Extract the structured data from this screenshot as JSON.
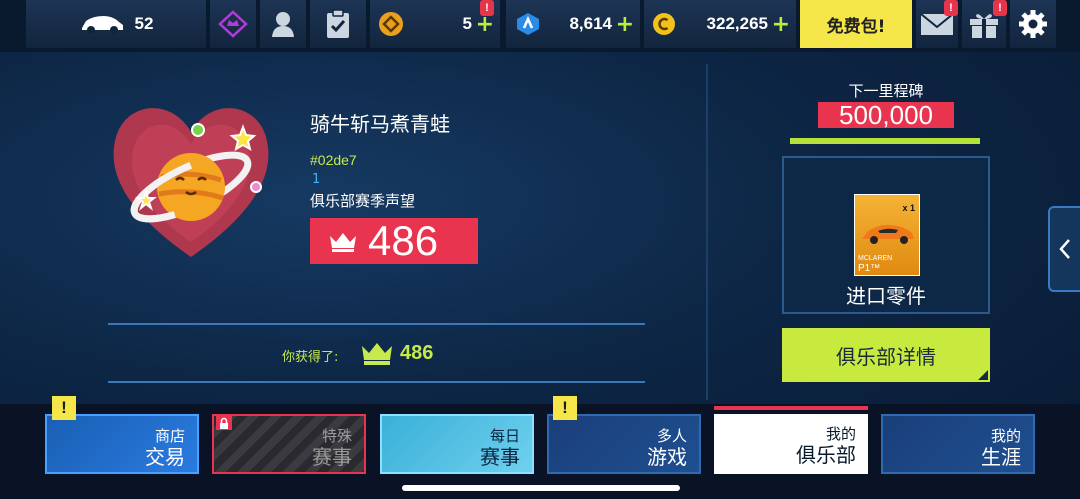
{
  "topbar": {
    "cars_count": "52",
    "tokens": "5",
    "blueprints": "8,614",
    "credits": "322,265",
    "free_pack_label": "免费包!",
    "alert_mark": "!",
    "plus": "+"
  },
  "club": {
    "name": "骑牛斩马煮青蛙",
    "tag": "#02de7",
    "number": "1",
    "reputation_label": "俱乐部赛季声望",
    "reputation_value": "486",
    "earned_label": "你获得了:",
    "earned_value": "486"
  },
  "milestone": {
    "label": "下一里程碑",
    "value": "500,000",
    "progress": 1.0,
    "reward_label": "进口零件",
    "reward_card_brand": "MCLAREN",
    "reward_card_model": "P1™",
    "reward_card_qty": "x 1"
  },
  "club_details_button": "俱乐部详情",
  "bottom_nav": [
    {
      "line1": "商店",
      "line2": "交易",
      "alert": true,
      "locked": false,
      "active": false
    },
    {
      "line1": "特殊",
      "line2": "赛事",
      "alert": false,
      "locked": true,
      "active": false
    },
    {
      "line1": "每日",
      "line2": "赛事",
      "alert": false,
      "locked": false,
      "active": false
    },
    {
      "line1": "多人",
      "line2": "游戏",
      "alert": true,
      "locked": false,
      "active": false
    },
    {
      "line1": "我的",
      "line2": "俱乐部",
      "alert": false,
      "locked": false,
      "active": true
    },
    {
      "line1": "我的",
      "line2": "生涯",
      "alert": false,
      "locked": false,
      "active": false
    }
  ],
  "colors": {
    "accent_green": "#c8ea3e",
    "accent_red": "#e8344f",
    "accent_yellow": "#f5e64a"
  }
}
